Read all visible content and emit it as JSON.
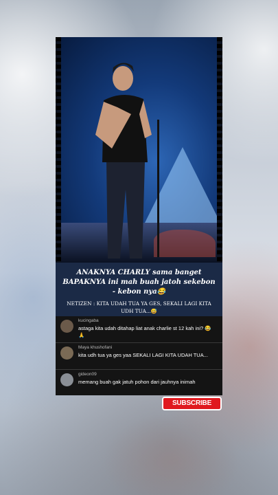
{
  "caption": {
    "title": "ANAKNYA CHARLY sama banget BAPAKNYA ini mah buah jatoh sekebon - kebon nya😂",
    "subtitle": "NETIZEN : KITA UDAH TUA YA GES, SEKALI LAGI KITA UDH TUA...😅"
  },
  "comments": [
    {
      "user": "kucingaba",
      "text": "astaga kita udah ditahap liat anak charlie st 12 kah ini? 😂 🙏",
      "avatar_color": "#6b5a4a"
    },
    {
      "user": "Maya khushofani",
      "text": "kita udh tua ya ges yaa SEKALI LAGI KITA UDAH TUA...",
      "avatar_color": "#7a6a55"
    },
    {
      "user": "gideon09",
      "text": "memang buah gak jatuh pohon dari jauhnya inimah",
      "avatar_color": "#8a8f96"
    }
  ],
  "subscribe": {
    "label": "SUBSCRIBE",
    "color": "#e0191f"
  }
}
